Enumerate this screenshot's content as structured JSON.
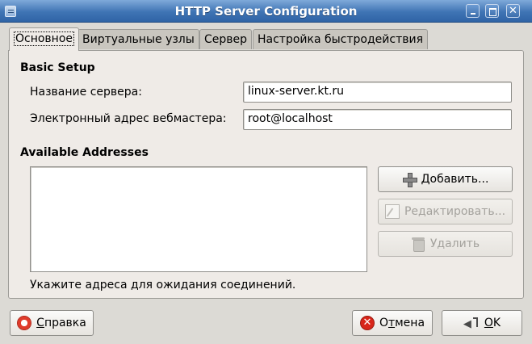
{
  "window": {
    "title": "HTTP Server Configuration"
  },
  "tabs": [
    {
      "label": "Основное",
      "active": true
    },
    {
      "label": "Виртуальные узлы",
      "active": false
    },
    {
      "label": "Сервер",
      "active": false
    },
    {
      "label": "Настройка быстродействия",
      "active": false
    }
  ],
  "basic_setup": {
    "heading": "Basic Setup",
    "server_name_label": "Название сервера:",
    "server_name_value": "linux-server.kt.ru",
    "webmaster_label": "Электронный адрес вебмастера:",
    "webmaster_value": "root@localhost"
  },
  "addresses": {
    "heading": "Available Addresses",
    "add_label": "Добавить...",
    "edit_label": "Редактировать...",
    "delete_label": "Удалить",
    "hint": "Укажите адреса для ожидания соединений."
  },
  "footer": {
    "help_mnemonic": "С",
    "help_rest": "правка",
    "cancel_prefix": "О",
    "cancel_mnemonic": "т",
    "cancel_rest": "мена",
    "ok_mnemonic": "O",
    "ok_rest": "K"
  },
  "icons": {
    "window_menu": "window-menu-icon",
    "minimize": "minimize-icon",
    "maximize": "maximize-icon",
    "close": "close-icon",
    "add": "plus-icon",
    "edit": "edit-icon",
    "delete": "trash-icon",
    "help": "lifebuoy-icon",
    "cancel": "cancel-icon",
    "ok": "enter-arrow-icon"
  },
  "colors": {
    "titlebar": "#3f74b4",
    "window_bg": "#dcdad5",
    "panel_bg": "#efebe7"
  }
}
